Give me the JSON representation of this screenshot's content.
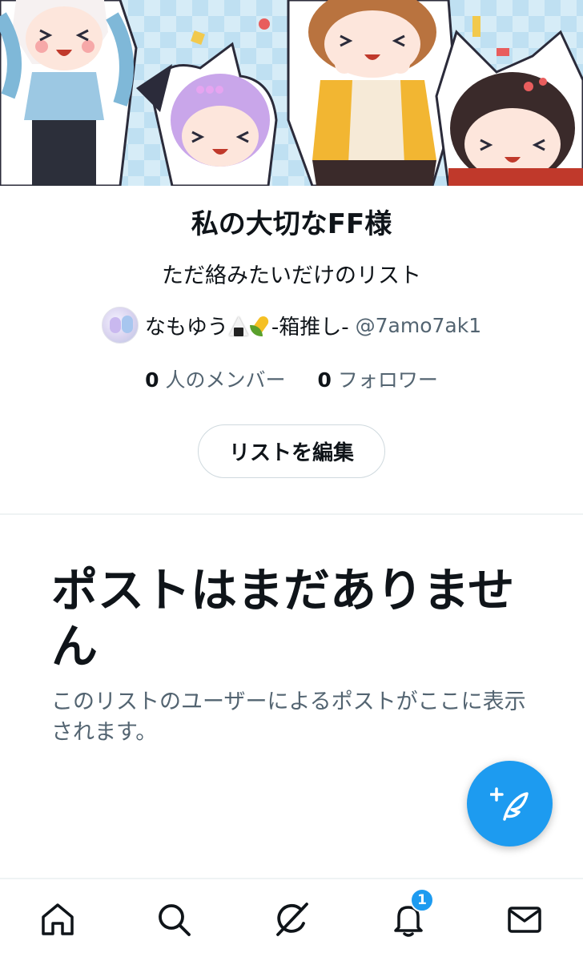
{
  "list": {
    "title": "私の大切なFF様",
    "description": "ただ絡みたいだけのリスト",
    "owner": {
      "name_before": "なもゆう",
      "name_after": "-箱推し-",
      "emoji_1": "rice-ball-emoji",
      "emoji_2": "corn-emoji",
      "handle": "@7amo7ak1"
    },
    "members": {
      "count": "0",
      "label": "人のメンバー"
    },
    "followers": {
      "count": "0",
      "label": "フォロワー"
    },
    "edit_button_label": "リストを編集"
  },
  "empty_state": {
    "title": "ポストはまだありません",
    "description": "このリストのユーザーによるポストがここに表示されます。"
  },
  "nav": {
    "items": [
      {
        "icon": "home-icon"
      },
      {
        "icon": "search-icon"
      },
      {
        "icon": "grok-icon"
      },
      {
        "icon": "bell-icon",
        "badge": "1"
      },
      {
        "icon": "mail-icon"
      }
    ]
  },
  "colors": {
    "accent": "#1d9bf0",
    "text_primary": "#0f1419",
    "text_secondary": "#536471",
    "border": "#cfd9de"
  }
}
